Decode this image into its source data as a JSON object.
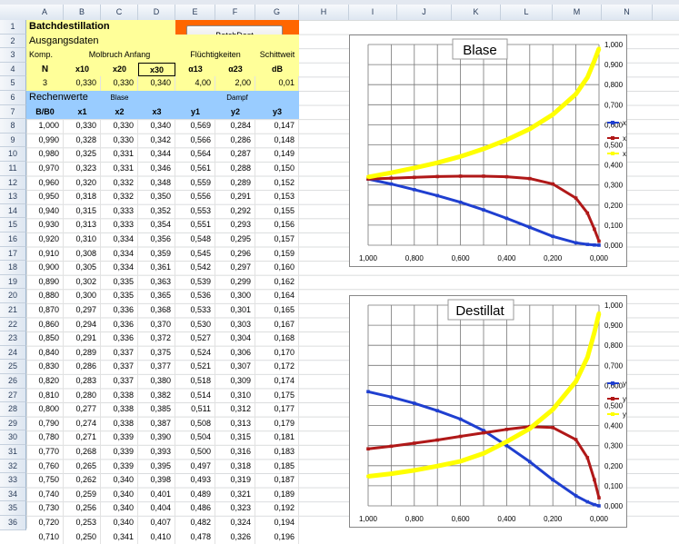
{
  "columns": [
    "A",
    "B",
    "C",
    "D",
    "E",
    "F",
    "G",
    "H",
    "I",
    "J",
    "K",
    "L",
    "M",
    "N"
  ],
  "header": {
    "title": "Batchdestillation",
    "ausgang": "Ausgangsdaten",
    "komp": "Komp.",
    "molbruch": "Molbruch Anfang",
    "fluecht": "Flüchtigkeiten",
    "schitt": "Schittweit",
    "N": "N",
    "x10": "x10",
    "x20": "x20",
    "x30": "x30",
    "a13": "α13",
    "a23": "α23",
    "dB": "dB",
    "vN": "3",
    "vx10": "0,330",
    "vx20": "0,330",
    "vx30": "0,340",
    "va13": "4,00",
    "va23": "2,00",
    "vdB": "0,01",
    "rechen": "Rechenwerte",
    "blase": "Blase",
    "dampf": "Dampf",
    "cols": [
      "B/B0",
      "x1",
      "x2",
      "x3",
      "y1",
      "y2",
      "y3"
    ],
    "button": "BatchDest"
  },
  "rows": [
    [
      "1,000",
      "0,330",
      "0,330",
      "0,340",
      "0,569",
      "0,284",
      "0,147"
    ],
    [
      "0,990",
      "0,328",
      "0,330",
      "0,342",
      "0,566",
      "0,286",
      "0,148"
    ],
    [
      "0,980",
      "0,325",
      "0,331",
      "0,344",
      "0,564",
      "0,287",
      "0,149"
    ],
    [
      "0,970",
      "0,323",
      "0,331",
      "0,346",
      "0,561",
      "0,288",
      "0,150"
    ],
    [
      "0,960",
      "0,320",
      "0,332",
      "0,348",
      "0,559",
      "0,289",
      "0,152"
    ],
    [
      "0,950",
      "0,318",
      "0,332",
      "0,350",
      "0,556",
      "0,291",
      "0,153"
    ],
    [
      "0,940",
      "0,315",
      "0,333",
      "0,352",
      "0,553",
      "0,292",
      "0,155"
    ],
    [
      "0,930",
      "0,313",
      "0,333",
      "0,354",
      "0,551",
      "0,293",
      "0,156"
    ],
    [
      "0,920",
      "0,310",
      "0,334",
      "0,356",
      "0,548",
      "0,295",
      "0,157"
    ],
    [
      "0,910",
      "0,308",
      "0,334",
      "0,359",
      "0,545",
      "0,296",
      "0,159"
    ],
    [
      "0,900",
      "0,305",
      "0,334",
      "0,361",
      "0,542",
      "0,297",
      "0,160"
    ],
    [
      "0,890",
      "0,302",
      "0,335",
      "0,363",
      "0,539",
      "0,299",
      "0,162"
    ],
    [
      "0,880",
      "0,300",
      "0,335",
      "0,365",
      "0,536",
      "0,300",
      "0,164"
    ],
    [
      "0,870",
      "0,297",
      "0,336",
      "0,368",
      "0,533",
      "0,301",
      "0,165"
    ],
    [
      "0,860",
      "0,294",
      "0,336",
      "0,370",
      "0,530",
      "0,303",
      "0,167"
    ],
    [
      "0,850",
      "0,291",
      "0,336",
      "0,372",
      "0,527",
      "0,304",
      "0,168"
    ],
    [
      "0,840",
      "0,289",
      "0,337",
      "0,375",
      "0,524",
      "0,306",
      "0,170"
    ],
    [
      "0,830",
      "0,286",
      "0,337",
      "0,377",
      "0,521",
      "0,307",
      "0,172"
    ],
    [
      "0,820",
      "0,283",
      "0,337",
      "0,380",
      "0,518",
      "0,309",
      "0,174"
    ],
    [
      "0,810",
      "0,280",
      "0,338",
      "0,382",
      "0,514",
      "0,310",
      "0,175"
    ],
    [
      "0,800",
      "0,277",
      "0,338",
      "0,385",
      "0,511",
      "0,312",
      "0,177"
    ],
    [
      "0,790",
      "0,274",
      "0,338",
      "0,387",
      "0,508",
      "0,313",
      "0,179"
    ],
    [
      "0,780",
      "0,271",
      "0,339",
      "0,390",
      "0,504",
      "0,315",
      "0,181"
    ],
    [
      "0,770",
      "0,268",
      "0,339",
      "0,393",
      "0,500",
      "0,316",
      "0,183"
    ],
    [
      "0,760",
      "0,265",
      "0,339",
      "0,395",
      "0,497",
      "0,318",
      "0,185"
    ],
    [
      "0,750",
      "0,262",
      "0,340",
      "0,398",
      "0,493",
      "0,319",
      "0,187"
    ],
    [
      "0,740",
      "0,259",
      "0,340",
      "0,401",
      "0,489",
      "0,321",
      "0,189"
    ],
    [
      "0,730",
      "0,256",
      "0,340",
      "0,404",
      "0,486",
      "0,323",
      "0,192"
    ],
    [
      "0,720",
      "0,253",
      "0,340",
      "0,407",
      "0,482",
      "0,324",
      "0,194"
    ],
    [
      "0,710",
      "0,250",
      "0,341",
      "0,410",
      "0,478",
      "0,326",
      "0,196"
    ]
  ],
  "chart_data": [
    {
      "type": "line",
      "title": "Blase",
      "x": [
        1.0,
        0.9,
        0.8,
        0.7,
        0.6,
        0.5,
        0.4,
        0.3,
        0.2,
        0.1,
        0.05,
        0.02,
        0.0
      ],
      "xlim": [
        1.0,
        0.0
      ],
      "ylim": [
        0,
        1
      ],
      "xticks": [
        "1,000",
        "0,800",
        "0,600",
        "0,400",
        "0,200",
        "0,000"
      ],
      "yticks": [
        "0,000",
        "0,100",
        "0,200",
        "0,300",
        "0,400",
        "0,500",
        "0,600",
        "0,700",
        "0,800",
        "0,900",
        "1,000"
      ],
      "series": [
        {
          "name": "x1",
          "color": "#1f3fd0",
          "values": [
            0.33,
            0.305,
            0.277,
            0.247,
            0.214,
            0.176,
            0.134,
            0.089,
            0.044,
            0.012,
            0.004,
            0.001,
            0.0
          ]
        },
        {
          "name": "x2",
          "color": "#b01818",
          "values": [
            0.33,
            0.334,
            0.338,
            0.342,
            0.344,
            0.344,
            0.341,
            0.332,
            0.305,
            0.235,
            0.16,
            0.08,
            0.02
          ]
        },
        {
          "name": "x3",
          "color": "#ffff00",
          "values": [
            0.34,
            0.361,
            0.385,
            0.411,
            0.442,
            0.48,
            0.525,
            0.579,
            0.651,
            0.753,
            0.836,
            0.919,
            0.98
          ]
        }
      ],
      "legend": "right"
    },
    {
      "type": "line",
      "title": "Destillat",
      "x": [
        1.0,
        0.9,
        0.8,
        0.7,
        0.6,
        0.5,
        0.4,
        0.3,
        0.2,
        0.1,
        0.05,
        0.02,
        0.0
      ],
      "xlim": [
        1.0,
        0.0
      ],
      "ylim": [
        0,
        1
      ],
      "xticks": [
        "1,000",
        "0,800",
        "0,600",
        "0,400",
        "0,200",
        "0,000"
      ],
      "yticks": [
        "0,000",
        "0,100",
        "0,200",
        "0,300",
        "0,400",
        "0,500",
        "0,600",
        "0,700",
        "0,800",
        "0,900",
        "1,000"
      ],
      "series": [
        {
          "name": "y1",
          "color": "#1f3fd0",
          "values": [
            0.569,
            0.542,
            0.511,
            0.474,
            0.432,
            0.375,
            0.3,
            0.22,
            0.13,
            0.05,
            0.02,
            0.006,
            0.0
          ]
        },
        {
          "name": "y2",
          "color": "#b01818",
          "values": [
            0.284,
            0.297,
            0.312,
            0.328,
            0.346,
            0.364,
            0.381,
            0.395,
            0.39,
            0.33,
            0.24,
            0.13,
            0.04
          ]
        },
        {
          "name": "y3",
          "color": "#ffff00",
          "values": [
            0.147,
            0.16,
            0.177,
            0.198,
            0.222,
            0.261,
            0.32,
            0.385,
            0.48,
            0.62,
            0.74,
            0.864,
            0.96
          ]
        }
      ],
      "legend": "right"
    }
  ]
}
